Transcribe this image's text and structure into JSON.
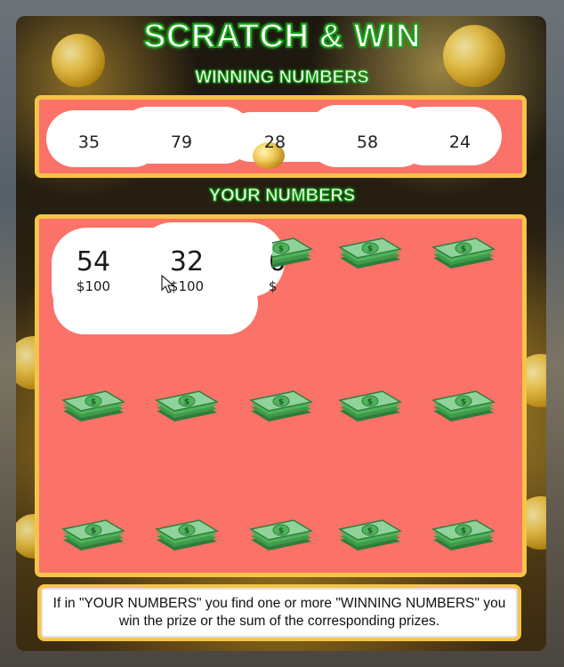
{
  "title": "SCRATCH & WIN",
  "winning_heading": "WINNING NUMBERS",
  "your_heading": "YOUR NUMBERS",
  "winning_numbers": [
    "35",
    "79",
    "28",
    "58",
    "24"
  ],
  "your_numbers": [
    {
      "number": "54",
      "prize": "$100"
    },
    {
      "number": "32",
      "prize": "$100"
    },
    {
      "number": "6",
      "prize": "$"
    }
  ],
  "instructions": "If in \"YOUR NUMBERS\" you find one or more \"WINNING NUMBERS\" you win the prize or the sum of the corresponding prizes.",
  "colors": {
    "panel_fill": "#fa7268",
    "panel_border": "#f6c448",
    "title_outline": "#16a016"
  },
  "icons": {
    "hidden_cell": "money-stack-icon",
    "cursor": "mouse-cursor-icon"
  }
}
